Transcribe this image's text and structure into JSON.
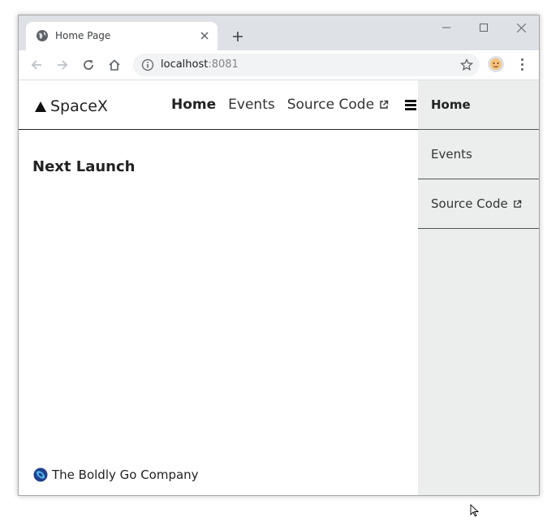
{
  "browser": {
    "tab": {
      "title": "Home Page"
    },
    "address": {
      "host": "localhost",
      "port": ":8081"
    }
  },
  "site": {
    "brand": "SpaceX",
    "nav": [
      {
        "label": "Home",
        "active": true
      },
      {
        "label": "Events",
        "active": false
      },
      {
        "label": "Source Code",
        "external": true
      }
    ],
    "main_title": "Next Launch",
    "footer": "The Boldly Go Company",
    "sidebar": [
      {
        "label": "Home",
        "active": true
      },
      {
        "label": "Events",
        "active": false
      },
      {
        "label": "Source Code",
        "external": true
      }
    ]
  },
  "colors": {
    "tabstrip": "#dee1e6",
    "sidebar_bg": "#eceeee",
    "footer_logo": "#1f6fb2"
  }
}
